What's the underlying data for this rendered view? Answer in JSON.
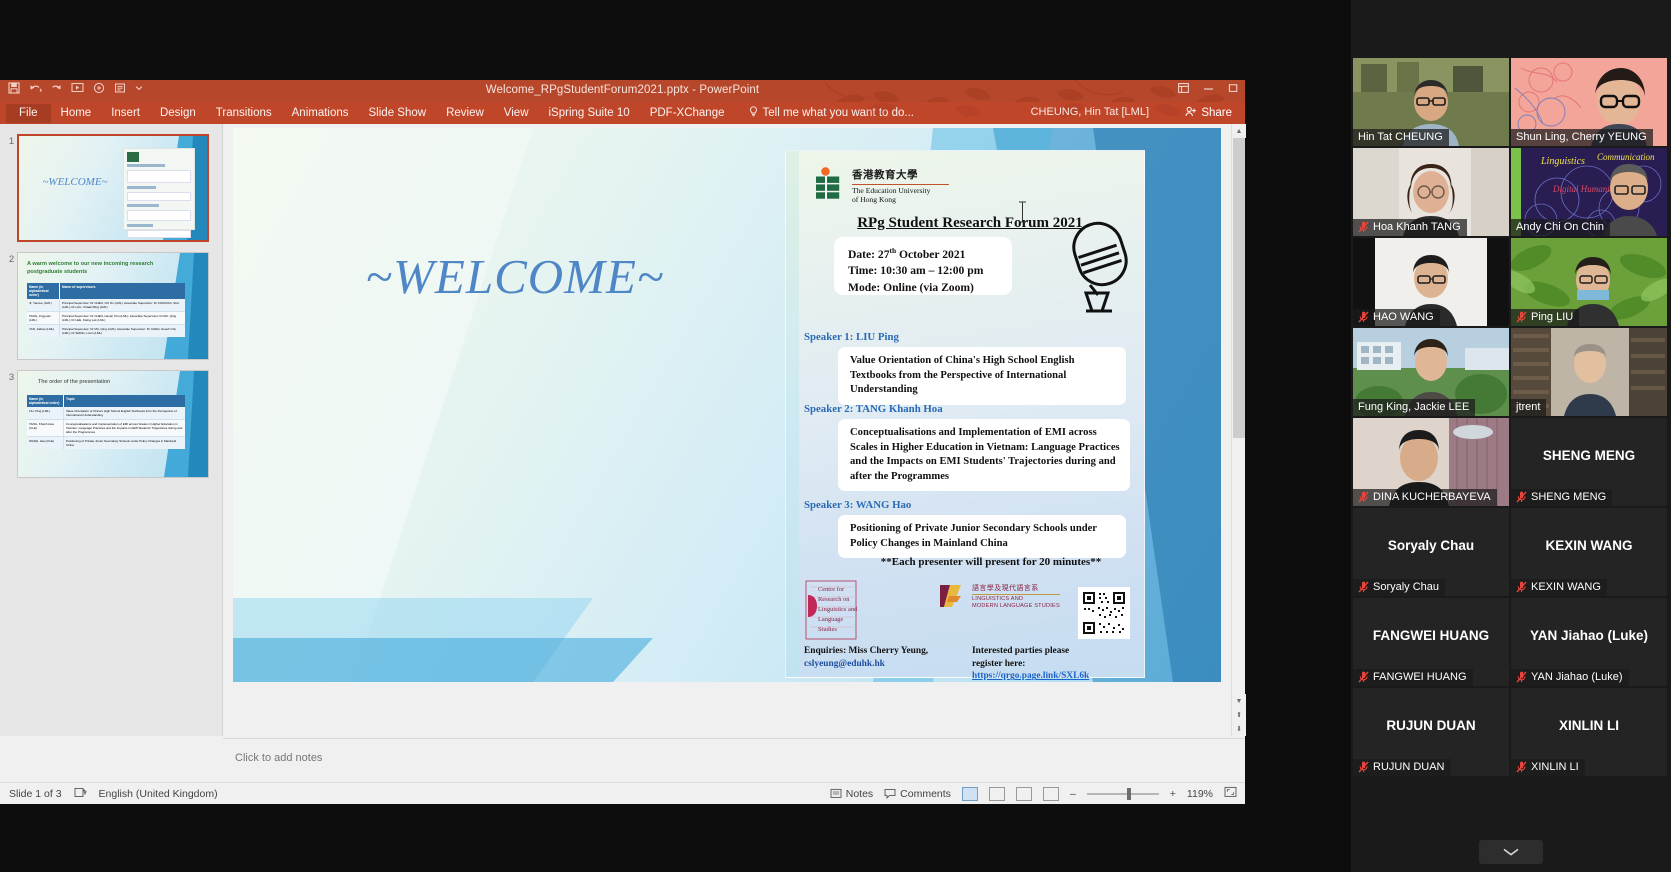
{
  "app": {
    "title": "Welcome_RPgStudentForum2021.pptx - PowerPoint",
    "account": "CHEUNG, Hin Tat [LML]",
    "share_label": "Share",
    "quick_access": [
      "save-icon",
      "undo-icon",
      "redo-icon",
      "start-from-beginning-icon",
      "ispring-icon",
      "ispring-quiz-icon",
      "customize-qat-icon"
    ],
    "window_controls": [
      "ribbon-display-options-icon",
      "minimize-icon",
      "restore-icon"
    ]
  },
  "ribbon": {
    "tabs": [
      "File",
      "Home",
      "Insert",
      "Design",
      "Transitions",
      "Animations",
      "Slide Show",
      "Review",
      "View",
      "iSpring Suite 10",
      "PDF-XChange"
    ],
    "tell_me": "Tell me what you want to do..."
  },
  "thumbnails": [
    {
      "number": "1",
      "selected": true,
      "title": "~WELCOME~"
    },
    {
      "number": "2",
      "selected": false,
      "title": "A warm welcome to our new incoming research postgraduate students"
    },
    {
      "number": "3",
      "selected": false,
      "title": "The order of the presentation"
    }
  ],
  "thumb2": {
    "heading": "A warm welcome to our new incoming research postgraduate students",
    "table_headers": [
      "Name (in alphabetical order)",
      "Name of supervisors"
    ],
    "rows": [
      {
        "name": "JI, Yanxue (LML)",
        "sup": "Principal Supervisor: Dr CHEN, Chi On (LML); Associate Supervisor: Dr KATAOKA, Shin (LML); Dr LAU, Chaak Ming (LML)"
      },
      {
        "name": "TANG, Jingyuan (LML)",
        "sup": "Principal Supervisor: Dr CHEN, Hsueh Chu (LML); Associate Supervisor: Dr MA, Qing (LML); Dr LEE, Kwing Lok (LML)"
      },
      {
        "name": "YAN, Jiahao (LML)",
        "sup": "Principal Supervisor: Dr MA, Qing (LML); Associate Supervisor: Dr CHEN, Hsueh Chu (LML); Dr WANG, Lixun (LML)"
      }
    ]
  },
  "thumb3": {
    "heading": "The order of the presentation",
    "table_headers": [
      "Name (in alphabetical order)",
      "Topic"
    ],
    "rows": [
      {
        "name": "LIU, Ping (LML)",
        "topic": "Value Orientation of China's High School English Textbooks from the Perspective of International Understanding"
      },
      {
        "name": "TANG, Khanh Hoa (CLE)",
        "topic": "Conceptualisations and Implementation of EMI across Scales in Higher Education in Vietnam: Language Practices and the Impacts on EMI Students' Trajectories during and after the Programmes"
      },
      {
        "name": "WANG, Hao (CLE)",
        "topic": "Positioning of Private Junior Secondary Schools under Policy Changes in Mainland China"
      }
    ]
  },
  "slide": {
    "welcome_text": "~WELCOME~",
    "poster": {
      "university_cn": "香港教育大學",
      "university_en_line1": "The Education University",
      "university_en_line2": "of Hong Kong",
      "title": "RPg Student Research Forum 2021",
      "details": [
        "Date: 27th October 2021",
        "Time: 10:30 am – 12:00 pm",
        "Mode: Online (via Zoom)"
      ],
      "date_prefix": "Date: 27",
      "date_sup": "th",
      "date_suffix": " October 2021",
      "time_line": "Time: 10:30 am – 12:00 pm",
      "mode_line": "Mode: Online (via Zoom)",
      "speakers": [
        {
          "label": "Speaker 1: LIU Ping",
          "topic": "Value Orientation of China's High School English Textbooks from the Perspective of International Understanding"
        },
        {
          "label": "Speaker 2: TANG Khanh Hoa",
          "topic": "Conceptualisations and Implementation of EMI across Scales in Higher Education in Vietnam: Language Practices and the Impacts on EMI Students' Trajectories during and after the Programmes"
        },
        {
          "label": "Speaker 3: WANG Hao",
          "topic": "Positioning of Private Junior Secondary Schools under Policy Changes in Mainland China"
        }
      ],
      "note": "**Each presenter will present for 20 minutes**",
      "crlls_lines": [
        "Centre for",
        "Research on",
        "Linguistics and",
        "Language",
        "Studies"
      ],
      "lmls_cn": "語言學及現代語言系",
      "lmls_en_line1": "LINGUISTICS AND",
      "lmls_en_line2": "MODERN LANGUAGE STUDIES",
      "enquiries_line1": "Enquiries: Miss Cherry Yeung,",
      "enquiries_email": "cslyeung@eduhk.hk",
      "register_line1": "Interested parties please",
      "register_line2": "register here:",
      "register_link": "https://qrgo.page.link/SXL6k"
    }
  },
  "notes": {
    "placeholder": "Click to add notes"
  },
  "status": {
    "slide_count": "Slide 1 of 3",
    "language": "English (United Kingdom)",
    "notes_label": "Notes",
    "comments_label": "Comments",
    "zoom_level": "119%",
    "views": [
      "normal-view-icon",
      "slide-sorter-icon",
      "reading-view-icon",
      "slide-show-icon"
    ]
  },
  "zoom_panel": {
    "participants": [
      {
        "name": "Hin Tat CHEUNG",
        "muted": false,
        "video": true,
        "speaking": false,
        "bg": "office-shelf"
      },
      {
        "name": "Shun Ling, Cherry YEUNG",
        "muted": false,
        "video": true,
        "speaking": false,
        "bg": "pink-floral"
      },
      {
        "name": "Hoa Khanh TANG",
        "muted": true,
        "video": true,
        "speaking": false,
        "bg": "indoor-light"
      },
      {
        "name": "Andy Chi On Chin",
        "muted": false,
        "video": true,
        "speaking": true,
        "bg": "linguistics-poster"
      },
      {
        "name": "HAO WANG",
        "muted": true,
        "video": true,
        "speaking": false,
        "bg": "white-room"
      },
      {
        "name": "Ping LIU",
        "muted": true,
        "video": true,
        "speaking": false,
        "bg": "green-leaves"
      },
      {
        "name": "Fung King, Jackie LEE",
        "muted": false,
        "video": true,
        "speaking": false,
        "bg": "campus-view"
      },
      {
        "name": "jtrent",
        "muted": false,
        "video": true,
        "speaking": false,
        "bg": "bookshelf"
      },
      {
        "name": "DINA KUCHERBAYEVA",
        "muted": true,
        "video": true,
        "speaking": false,
        "bg": "curtain-room"
      },
      {
        "name": "SHENG MENG",
        "muted": true,
        "video": false,
        "speaking": false,
        "bg": ""
      },
      {
        "name": "Soryaly Chau",
        "muted": true,
        "video": false,
        "speaking": false,
        "bg": ""
      },
      {
        "name": "KEXIN WANG",
        "muted": true,
        "video": false,
        "speaking": false,
        "bg": ""
      },
      {
        "name": "FANGWEI HUANG",
        "muted": true,
        "video": false,
        "speaking": false,
        "bg": ""
      },
      {
        "name": "YAN Jiahao (Luke)",
        "muted": true,
        "video": false,
        "speaking": false,
        "bg": ""
      },
      {
        "name": "RUJUN DUAN",
        "muted": true,
        "video": false,
        "speaking": false,
        "bg": ""
      },
      {
        "name": "XINLIN LI",
        "muted": true,
        "video": false,
        "speaking": false,
        "bg": ""
      }
    ],
    "collapse_icon": "chevron-down-icon"
  },
  "colors": {
    "ppt_accent": "#b7472a",
    "ppt_tabstrip": "#c0462a",
    "slide_blue": "#4f86c6",
    "speaker_label": "#2a6bb5",
    "zoom_bg": "#1a1a1a",
    "speaking_outline": "#ffe14d",
    "mute_red": "#e8453c"
  }
}
